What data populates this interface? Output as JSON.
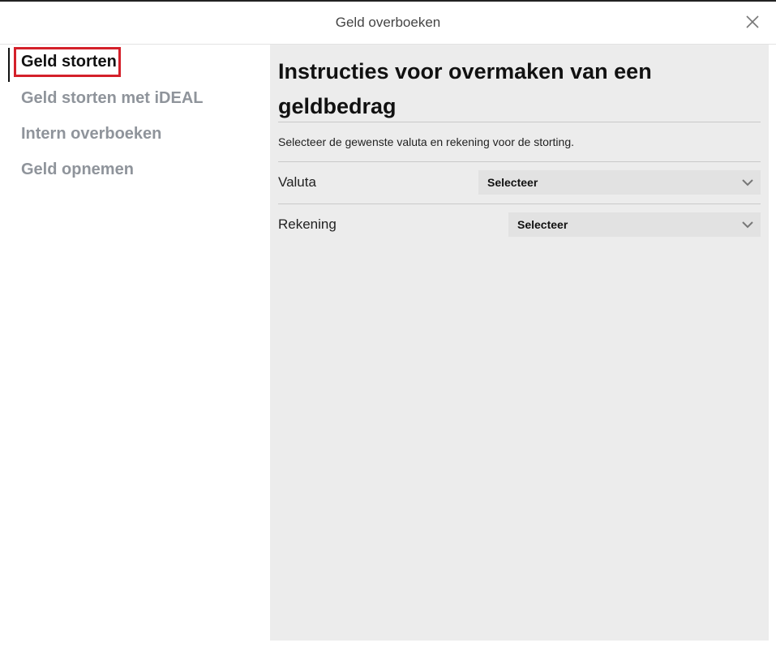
{
  "header": {
    "title": "Geld overboeken",
    "close_icon": "close-icon"
  },
  "sidebar": {
    "items": [
      {
        "label": "Geld storten",
        "active": true
      },
      {
        "label": "Geld storten met iDEAL",
        "active": false
      },
      {
        "label": "Intern overboeken",
        "active": false
      },
      {
        "label": "Geld opnemen",
        "active": false
      }
    ]
  },
  "main": {
    "title": "Instructies voor overmaken van een geldbedrag",
    "instructions": "Selecteer de gewenste valuta en rekening voor de storting.",
    "fields": [
      {
        "label": "Valuta",
        "selected": "Selecteer"
      },
      {
        "label": "Rekening",
        "selected": "Selecteer"
      }
    ]
  },
  "colors": {
    "highlight_border": "#d4202a",
    "panel_background": "#ececec",
    "select_background": "#e2e2e2",
    "inactive_text": "#8f949b"
  }
}
